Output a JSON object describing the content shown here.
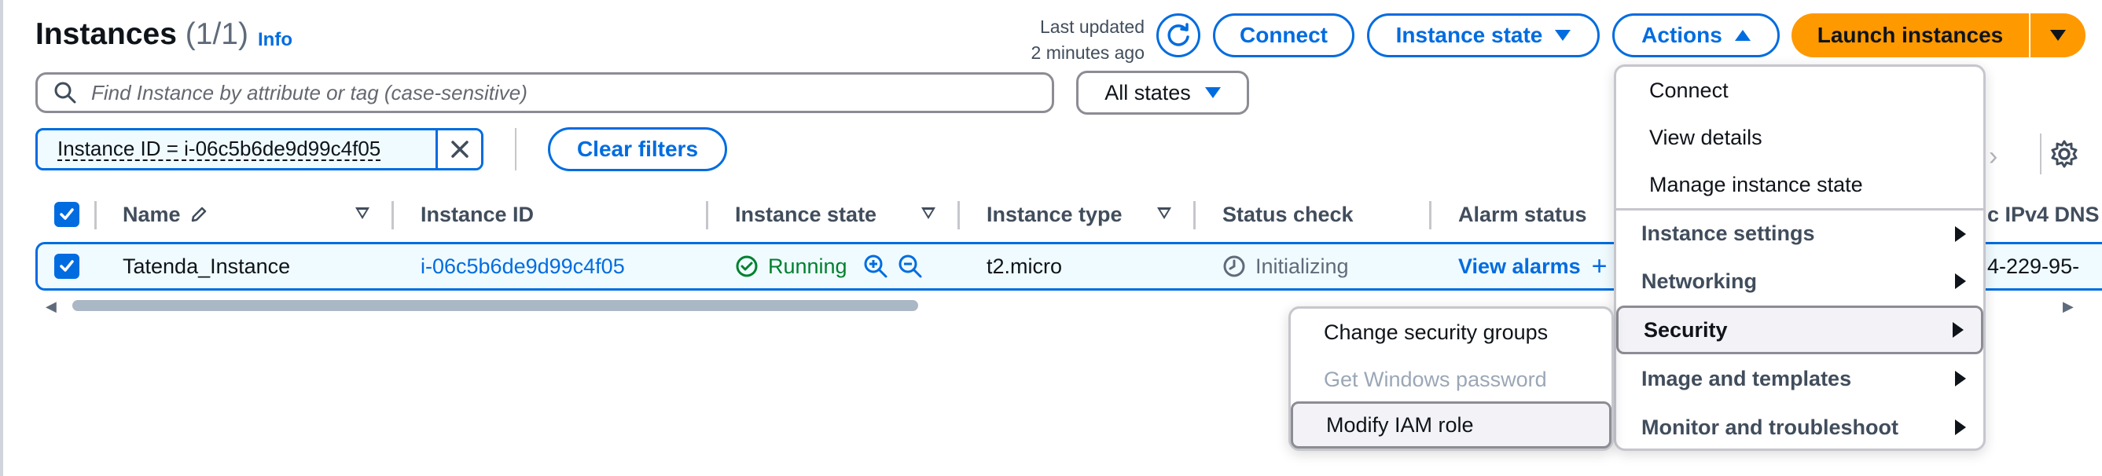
{
  "header": {
    "title": "Instances",
    "count": "(1/1)",
    "info": "Info",
    "last_updated_line1": "Last updated",
    "last_updated_line2": "2 minutes ago"
  },
  "toolbar": {
    "refresh_icon": "refresh-icon",
    "connect_label": "Connect",
    "instance_state_label": "Instance state",
    "actions_label": "Actions",
    "launch_label": "Launch instances"
  },
  "search": {
    "placeholder": "Find Instance by attribute or tag (case-sensitive)",
    "state_filter": "All states"
  },
  "filters": {
    "token": "Instance ID = i-06c5b6de9d99c4f05",
    "clear_label": "Clear filters"
  },
  "table": {
    "columns": [
      "Name",
      "Instance ID",
      "Instance state",
      "Instance type",
      "Status check",
      "Alarm status",
      "c IPv4 DNS"
    ],
    "rows": [
      {
        "name": "Tatenda_Instance",
        "instance_id": "i-06c5b6de9d99c4f05",
        "state": "Running",
        "type": "t2.micro",
        "status_check": "Initializing",
        "alarm": "View alarms",
        "ipv4": "4-229-95-"
      }
    ]
  },
  "actions_menu": {
    "items": [
      {
        "label": "Connect"
      },
      {
        "label": "View details"
      },
      {
        "label": "Manage instance state"
      },
      {
        "label": "Instance settings"
      },
      {
        "label": "Networking"
      },
      {
        "label": "Security"
      },
      {
        "label": "Image and templates"
      },
      {
        "label": "Monitor and troubleshoot"
      }
    ]
  },
  "security_submenu": {
    "items": [
      {
        "label": "Change security groups",
        "enabled": true
      },
      {
        "label": "Get Windows password",
        "enabled": false
      },
      {
        "label": "Modify IAM role",
        "enabled": true
      }
    ]
  },
  "colors": {
    "accent": "#006ce0",
    "launch": "#ff9900",
    "running": "#00802f",
    "selected_row": "#f0fbff"
  }
}
